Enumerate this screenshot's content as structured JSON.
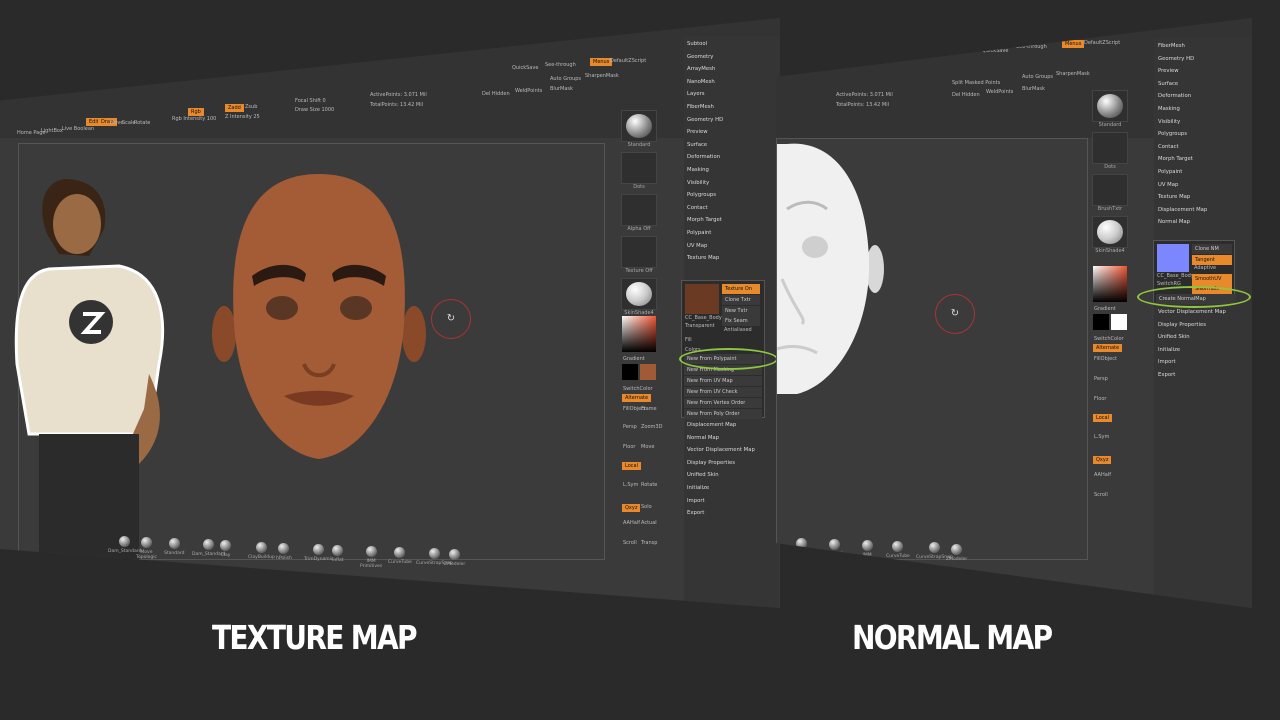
{
  "captions": {
    "left": "TEXTURE MAP",
    "right": "NORMAL MAP"
  },
  "topbar": {
    "quicksave": "QuickSave",
    "see_through": "See-through",
    "see_through_value": "0",
    "menus": "Menus",
    "script": "DefaultZScript",
    "ac": "AC",
    "auto_groups": "Auto Groups",
    "sharpen_mask": "SharpenMask",
    "del_hidden": "Del Hidden",
    "weld_points": "WeldPoints",
    "blur_mask": "BlurMask",
    "split_masked": "Split Masked Points",
    "zadd": "Zadd",
    "zsub": "Zsub",
    "mrgb": "Mrgb",
    "rgb": "Rgb",
    "focal_shift": "Focal Shift 0",
    "draw_size": "Draw Size 1000",
    "dynamic": "Dynamic",
    "active_points": "ActivePoints: 3.071 Mil",
    "total_points": "TotalPoints: 13.42 Mil",
    "mirror": "Mirror",
    "mirror_weld": "Mirror And Weld",
    "z_intensity": "Z Intensity 25",
    "rgb_intensity": "Rgb Intensity 100",
    "home_page": "Home Page",
    "lightbox": "LightBox",
    "live_boolean": "Live Boolean",
    "edit": "Edit",
    "draw": "Draw",
    "move": "Move",
    "scale": "Scale",
    "rotate": "Rotate"
  },
  "left_tools": {
    "standard": "Standard",
    "dots": "Dots",
    "alpha_off": "Alpha Off",
    "texture_off": "Texture Off",
    "skinshade": "SkinShade4",
    "gradient": "Gradient",
    "switch_color": "SwitchColor",
    "alternate": "Alternate",
    "fill_object": "FillObject",
    "persp": "Persp",
    "floor": "Floor",
    "local": "Local",
    "lsym": "L.Sym",
    "xyz": "Qxyz",
    "frame": "Frame",
    "move": "Move",
    "zoom3d": "Zoom3D",
    "rotate": "Rotate",
    "polyf": "PolyF",
    "transp": "Transp",
    "solo": "Solo",
    "ghost": "Ghost",
    "xpose": "Xpose",
    "aahalf": "AAHalf",
    "actual": "Actual",
    "scroll": "Scroll",
    "brushtxtr": "BrushTxtr"
  },
  "left_menu": [
    "Subtool",
    "Geometry",
    "ArrayMesh",
    "NanoMesh",
    "Layers",
    "FiberMesh",
    "Geometry HD",
    "Preview",
    "Surface",
    "Deformation",
    "Masking",
    "Visibility",
    "Polygroups",
    "Contact",
    "Morph Target",
    "Polypaint",
    "UV Map",
    "Texture Map"
  ],
  "left_menu_bottom": [
    "Displacement Map",
    "Normal Map",
    "Vector Displacement Map",
    "Display Properties",
    "Unified Skin",
    "Initialize",
    "Import",
    "Export"
  ],
  "texture_popup": {
    "thumb_label": "CC_Base_Body",
    "transparent": "Transparent",
    "texture_on": "Texture On",
    "clone_txtr": "Clone Txtr",
    "new_txtr": "New Txtr",
    "fix_seam": "Fix Seam",
    "antialiased": "Antialiased",
    "fill": "Fill",
    "colors": "Colors",
    "rows": [
      "New From Polypaint",
      "New From Masking",
      "New From UV Map",
      "New From UV Check",
      "New From Vertex Order",
      "New From Poly Order"
    ]
  },
  "right_menu": [
    "FiberMesh",
    "Geometry HD",
    "Preview",
    "Surface",
    "Deformation",
    "Masking",
    "Visibility",
    "Polygroups",
    "Contact",
    "Morph Target",
    "Polypaint",
    "UV Map",
    "Texture Map",
    "Displacement Map",
    "Normal Map"
  ],
  "right_menu_bottom": [
    "Vector Displacement Map",
    "Display Properties",
    "Unified Skin",
    "Initialize",
    "Import",
    "Export"
  ],
  "normal_popup": {
    "thumb_label": "CC_Base_Body",
    "switch_rg": "SwitchRG",
    "clone_nm": "Clone NM",
    "tangent": "Tangent",
    "adaptive": "Adaptive",
    "smooth_uv": "SmoothUV",
    "snormals": "SNormals",
    "create": "Create NormalMap"
  },
  "shelf_left": [
    "Dam_Standard",
    "Move Topologic",
    "Standard",
    "Dam_Standard",
    "Clay",
    "ClayBuildup",
    "hPolish",
    "TrimDynamic",
    "Inflat",
    "IMM Primitives",
    "CurveTube",
    "CurveStrapSnap",
    "ZModeler"
  ],
  "shelf_right": [
    "Inflat",
    "JhCut_A",
    "IMM Primitives",
    "CurveTube",
    "CurveStrapSnap",
    "ZModeler"
  ],
  "colors": {
    "accent": "#e8892b",
    "ring": "#8ec63f",
    "skin": "#a05a35",
    "swatch_blue": "#7b86ff"
  }
}
